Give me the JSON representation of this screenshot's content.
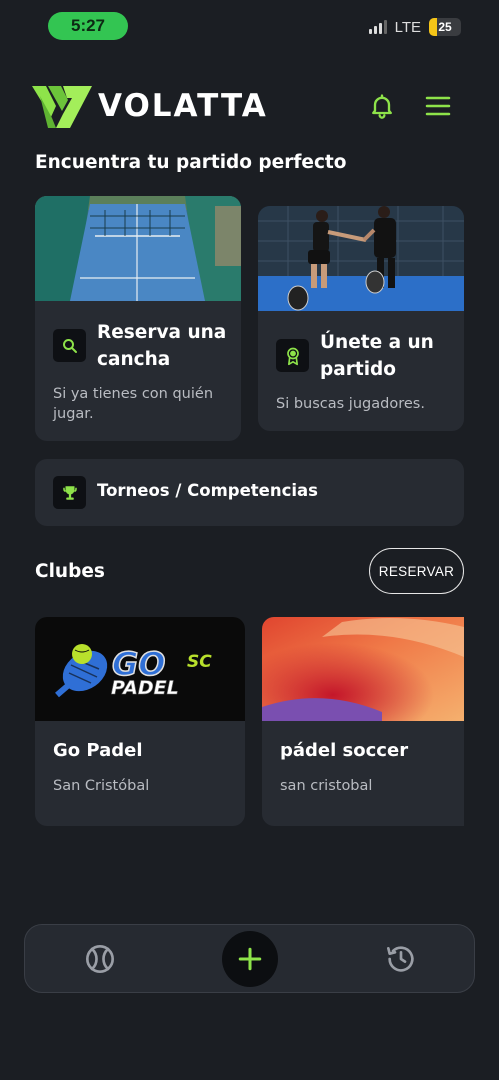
{
  "status_bar": {
    "time": "5:27",
    "network": "LTE",
    "battery": "25",
    "battery_level": 0.25
  },
  "header": {
    "brand": "VOLATTA",
    "accent_color": "#8ee34a",
    "icons": [
      "volatta-logo-icon",
      "bell-icon",
      "hamburger-menu-icon"
    ]
  },
  "main": {
    "section_title": "Encuentra tu partido perfecto",
    "cards": [
      {
        "title_line1": "Reserva una",
        "title_line2": "cancha",
        "subtitle_line1": "Si ya tienes con quién",
        "subtitle_line2": "jugar.",
        "icon": "search-icon"
      },
      {
        "title_line1": "Únete a un",
        "title_line2": "partido",
        "subtitle": "Si buscas jugadores.",
        "icon": "medal-icon"
      }
    ],
    "tournament": {
      "label": "Torneos / Competencias",
      "icon": "trophy-icon"
    }
  },
  "clubs": {
    "title": "Clubes",
    "reserve_label": "RESERVAR",
    "items": [
      {
        "name": "Go Padel",
        "location": "San Cristóbal",
        "logo_word1": "GO",
        "logo_word2": "PADEL",
        "logo_badge": "SC"
      },
      {
        "name": "pádel soccer",
        "location": "san cristobal"
      }
    ]
  },
  "bottom_nav": {
    "items": [
      "tennis-ball-icon",
      "plus-icon",
      "history-icon"
    ]
  }
}
